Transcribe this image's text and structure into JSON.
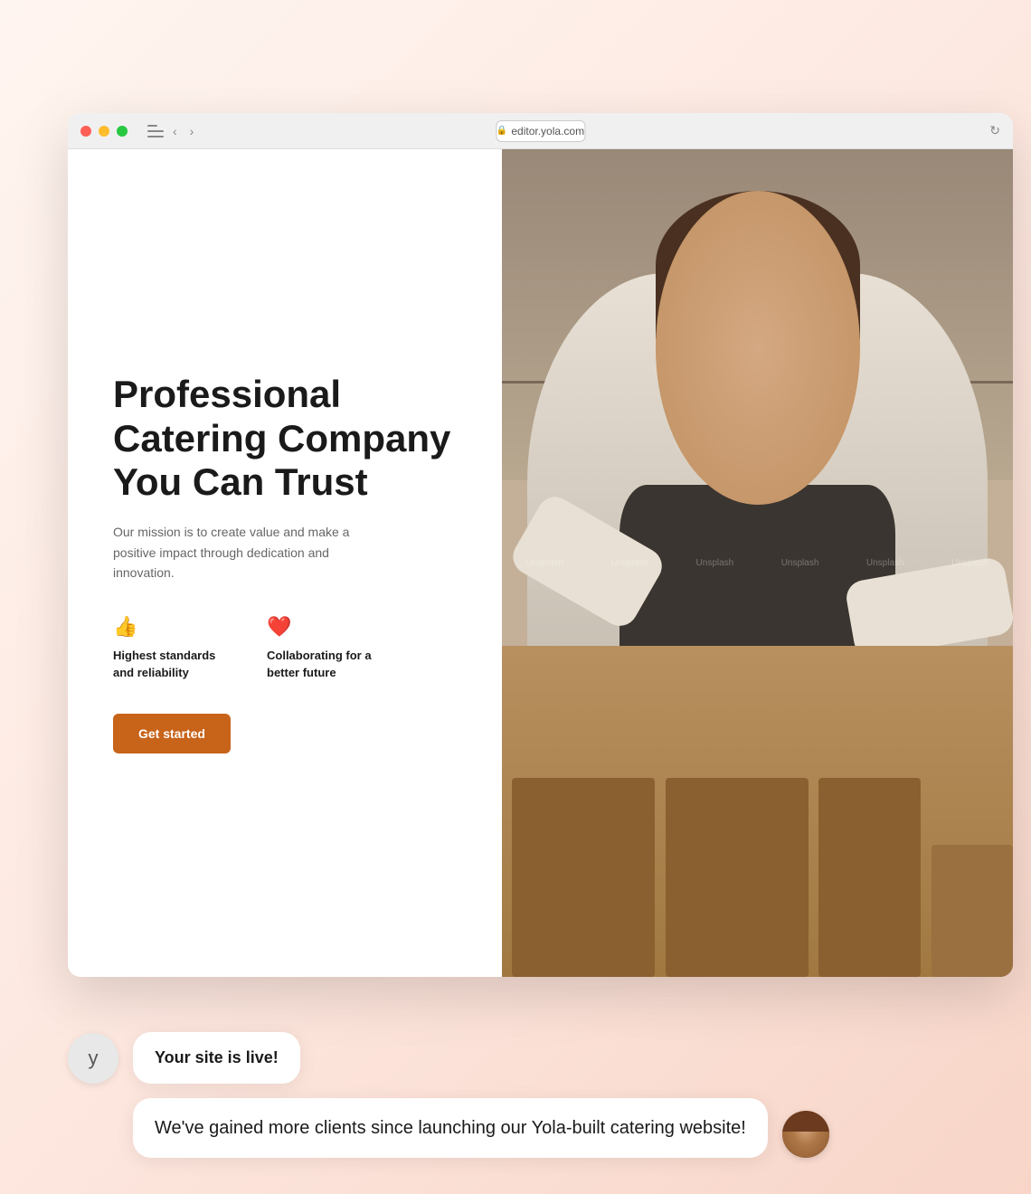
{
  "browser": {
    "url": "editor.yola.com",
    "traffic_lights": [
      "red",
      "yellow",
      "green"
    ]
  },
  "website": {
    "hero": {
      "title": "Professional Catering Company You Can Trust",
      "subtitle": "Our mission is to create value and make a positive impact through dedication and innovation.",
      "features": [
        {
          "icon": "👍",
          "text": "Highest standards and reliability"
        },
        {
          "icon": "❤️",
          "text": "Collaborating for a better future"
        }
      ],
      "cta_label": "Get started"
    }
  },
  "chat": {
    "yola_initial": "y",
    "bubble1": "Your site is live!",
    "bubble2": "We've gained more clients since launching our Yola-built catering website!"
  }
}
